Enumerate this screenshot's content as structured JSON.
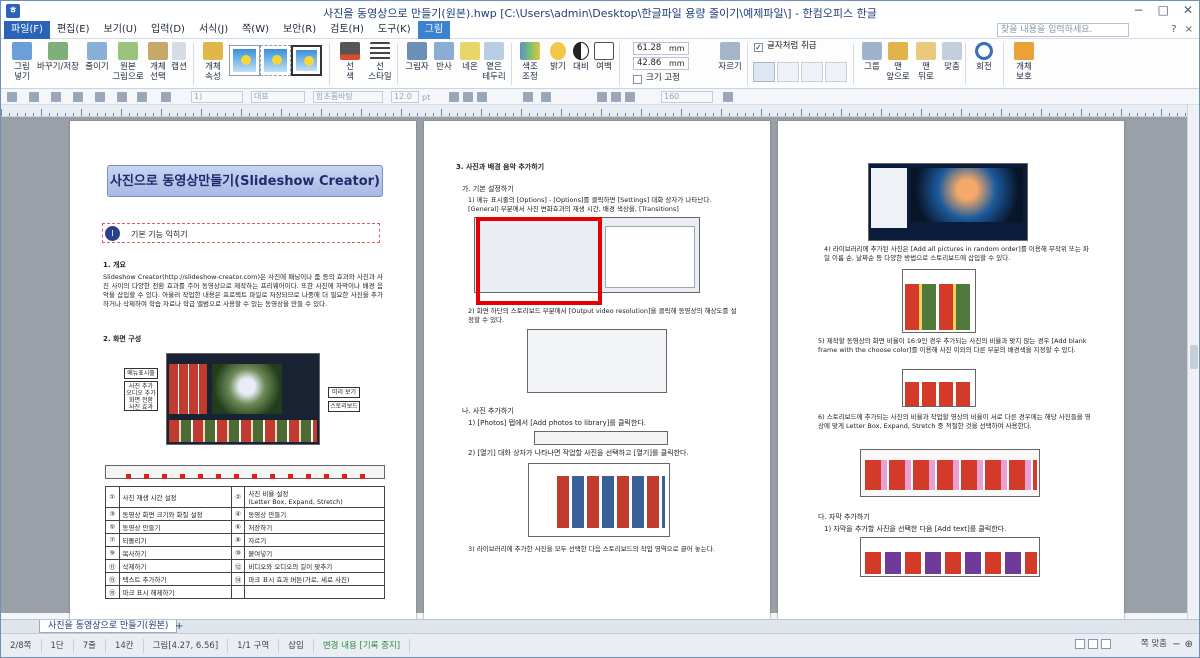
{
  "window": {
    "title": "사진을 동영상으로 만들기(원본).hwp [C:\\Users\\admin\\Desktop\\한글파일 용량 줄이기\\예제파일\\] - 한컴오피스 한글",
    "app_icon": "hwp-icon",
    "controls": [
      "−",
      "□",
      "✕"
    ]
  },
  "menu": {
    "items": [
      "파일(F)",
      "편집(E)",
      "보기(U)",
      "입력(D)",
      "서식(J)",
      "쪽(W)",
      "보안(R)",
      "검토(H)",
      "도구(K)",
      "그림"
    ],
    "active": "그림",
    "search_placeholder": "찾을 내용을 입력하세요.",
    "right": [
      "?",
      "×"
    ]
  },
  "ribbon": {
    "buttons": [
      {
        "label": "그림\n넣기",
        "icon": "insert-picture-icon"
      },
      {
        "label": "바꾸기/저장",
        "icon": "replace-picture-icon"
      },
      {
        "label": "줄이기",
        "icon": "shrink-picture-icon"
      },
      {
        "label": "원본\n그림으로",
        "icon": "original-picture-icon"
      },
      {
        "label": "개체\n선택",
        "icon": "select-object-icon"
      },
      {
        "label": "캡션",
        "icon": "caption-icon"
      },
      {
        "label": "개체\n속성",
        "icon": "object-properties-icon"
      },
      {
        "label": "선\n색",
        "icon": "line-color-icon"
      },
      {
        "label": "선\n스타일",
        "icon": "line-style-icon"
      },
      {
        "label": "그림자",
        "icon": "shadow-icon"
      },
      {
        "label": "반사",
        "icon": "reflection-icon"
      },
      {
        "label": "네온",
        "icon": "neon-icon"
      },
      {
        "label": "옅은\n테두리",
        "icon": "soft-edge-icon"
      },
      {
        "label": "색조\n조정",
        "icon": "color-adjust-icon"
      },
      {
        "label": "밝기",
        "icon": "brightness-icon"
      },
      {
        "label": "대비",
        "icon": "contrast-icon"
      },
      {
        "label": "여백",
        "icon": "margin-icon"
      },
      {
        "label": "자르기",
        "icon": "crop-icon"
      },
      {
        "label": "그룹",
        "icon": "group-icon"
      },
      {
        "label": "맨\n앞으로",
        "icon": "bring-front-icon"
      },
      {
        "label": "맨\n뒤로",
        "icon": "send-back-icon"
      },
      {
        "label": "맞춤",
        "icon": "align-icon"
      },
      {
        "label": "회전",
        "icon": "rotate-icon"
      },
      {
        "label": "개체\n보호",
        "icon": "protect-object-icon"
      }
    ],
    "width_value": "61.28",
    "height_value": "42.86",
    "unit": "mm",
    "fixed_size_label": "크기 고정",
    "treat_as_char_label": "글자처럼 취급",
    "treat_as_char_checked": true
  },
  "format_toolbar": {
    "style": "대표",
    "font": "함초롬바탕",
    "size": "12.0",
    "size_unit": "pt",
    "zoom": "160"
  },
  "pages": {
    "page1": {
      "header_title": "사진으로 동영상만들기(Slideshow Creator)",
      "section_num": "I",
      "section_title": "기본 기능 익히기",
      "s1_title": "1. 개요",
      "s1_body": "Slideshow Creator(http://slideshow-creator.com)은 사진에 패닝이나 줌 등의 효과와 사진과 사진 사이의 다양한 전환 효과를 주어 동영상으로 제작하는 프리웨어이다. 또한 사진에 자막이나 배경 음악을 삽입할 수 있다. 아울러 작업한 내용은 프로젝트 파일로 저장되므로 나중에 더 필요한 사진을 추가하거나 삭제하여 학습 자료나 학급 앨범으로 사용할 수 있는 동영상을 만들 수 있다.",
      "s2_title": "2. 화면 구성",
      "callouts": [
        "메뉴표시줄",
        "사진 추가\n오디오 추가\n화면 전환\n사진 효과",
        "미리 보기",
        "스토리보드"
      ],
      "legend": [
        [
          "①",
          "사진 재생 시간 설정",
          "②",
          "사진 비율 설정\n(Letter Box, Expand, Stretch)"
        ],
        [
          "③",
          "동영상 화면 크기와 화질 설정",
          "④",
          "동영상 만들기"
        ],
        [
          "⑤",
          "동영상 만들기",
          "⑥",
          "저장하기"
        ],
        [
          "⑦",
          "되돌리기",
          "⑧",
          "자르기"
        ],
        [
          "⑨",
          "복사하기",
          "⑩",
          "붙여넣기"
        ],
        [
          "⑪",
          "삭제하기",
          "⑫",
          "비디오와 오디오의 길이 맞추기"
        ],
        [
          "⑬",
          "텍스트 추가하기",
          "⑭",
          "마크 표시 효과 버튼(가로, 세로 사진)"
        ],
        [
          "⑮",
          "마크 표시 해제하기",
          "",
          ""
        ]
      ]
    },
    "page2": {
      "s3_title": "3. 사진과 배경 음악 추가하기",
      "s3a_title": "가. 기본 설정하기",
      "s3a_1": "1) 메뉴 표시줄의 [Options] - [Options]를 클릭하면 [Settings] 대화 상자가 나타난다. [General] 부분에서 사진 변화효과의 재생 시간, 배경 색상을, [Transitions]",
      "s3a_2": "2) 화면 하단의 스토리보드 부분에서 [Output video resolution]을 클릭해 동영상의 해상도를 설정할 수 있다.",
      "s3b_title": "나. 사진 추가하기",
      "s3b_1": "1) [Photos] 탭에서 [Add photos to library]를 클릭한다.",
      "s3b_2": "2) [열기] 대화 상자가 나타나면 작업할 사진을 선택하고 [열기]를 클릭한다.",
      "s3b_3": "3) 라이브러리에 추가한 사진을 모두 선택한 다음 스토리보드의 작업 영역으로 끌어 놓는다."
    },
    "page3": {
      "p4": "4) 라이브러리에 추가된 사진은 [Add all pictures in random order]를 이용해 무작위 또는 파일 이름 순, 날짜순 등 다양한 방법으로 스토리보드에 삽입할 수 있다.",
      "p5": "5) 제작할 동영상의 화면 비율이 16:9인 경우 추가되는 사진의 비율과 맞지 않는 경우 [Add blank frame with the choose color]를 이용해 사진 이외의 다른 부분의 배경색을 지정할 수 있다.",
      "p6": "6) 스토리보드에 추가되는 사진의 비율과 작업할 영상의 비율이 서로 다른 경우에는 해당 사진들을 영상에 맞게 Letter Box, Expand, Stretch 중 적절한 것을 선택하여 사용한다.",
      "d_title": "다. 자막 추가하기",
      "d_1": "1) 자막을 추가할 사진을 선택한 다음 [Add text]를 클릭한다."
    }
  },
  "tabs": {
    "doc_tab": "사진을 동영상으로 만들기(원본)",
    "add": "+"
  },
  "status": {
    "page": "2/8쪽",
    "column": "1단",
    "line": "7줄",
    "col": "14칸",
    "picture": "그림[4.27, 6.56]",
    "section": "1/1 구역",
    "mode": "삽입",
    "track": "변경 내용 [기록 중지]",
    "zoom_mode": "쪽 맞춤",
    "zoom_controls": [
      "−",
      "⊕"
    ]
  }
}
